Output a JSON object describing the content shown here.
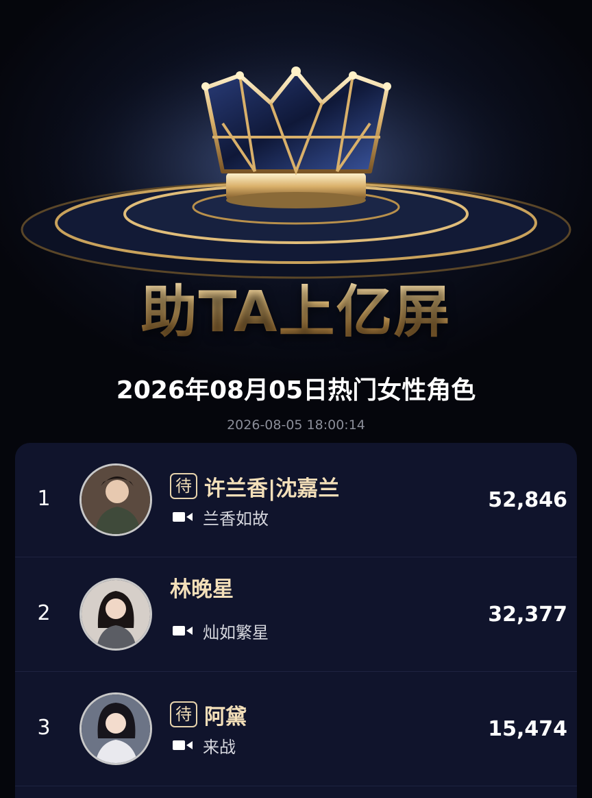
{
  "banner": {
    "title": "助TA上亿屏",
    "crown_icon": "crown-icon"
  },
  "list": {
    "title": "2026年08月05日热门女性角色",
    "timestamp": "2026-08-05 18:00:14"
  },
  "entries": [
    {
      "rank": "1",
      "tag": "待",
      "name": "许兰香|沈嘉兰",
      "drama": "兰香如故",
      "score": "52,846"
    },
    {
      "rank": "2",
      "tag": "",
      "name": "林晚星",
      "drama": "灿如繁星",
      "score": "32,377"
    },
    {
      "rank": "3",
      "tag": "待",
      "name": "阿黛",
      "drama": "来战",
      "score": "15,474"
    }
  ],
  "colors": {
    "gold": "#e3bd78",
    "panel": "#10142c",
    "name": "#f3dfb9"
  }
}
